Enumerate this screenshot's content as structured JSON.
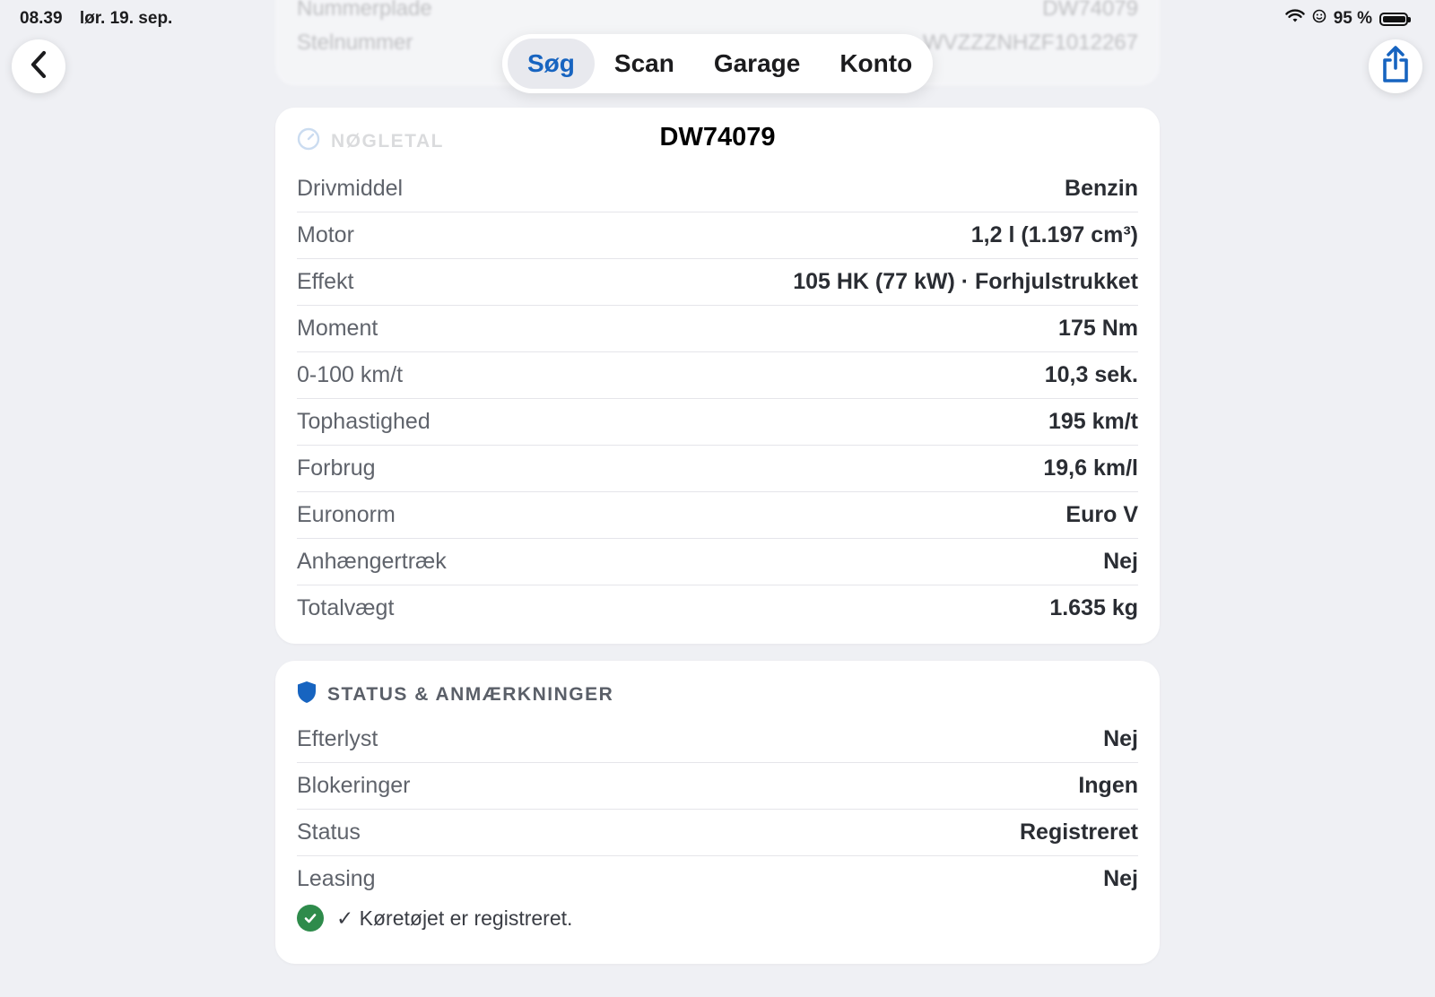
{
  "status_bar": {
    "time": "08.39",
    "date": "lør. 19. sep.",
    "battery": "95 %"
  },
  "nav_tabs": [
    {
      "label": "Søg",
      "active": true
    },
    {
      "label": "Scan",
      "active": false
    },
    {
      "label": "Garage",
      "active": false
    },
    {
      "label": "Konto",
      "active": false
    }
  ],
  "behind_card": {
    "rows": [
      {
        "label": "Nummerplade",
        "value": "DW74079"
      },
      {
        "label": "Stelnummer",
        "value": "WVZZZNHZF1012267"
      }
    ]
  },
  "key_figures": {
    "header": "NØGLETAL",
    "plate": "DW74079",
    "rows": [
      {
        "label": "Drivmiddel",
        "value": "Benzin"
      },
      {
        "label": "Motor",
        "value": "1,2 l (1.197 cm³)"
      },
      {
        "label": "Effekt",
        "value": "105 HK (77 kW) · Forhjulstrukket"
      },
      {
        "label": "Moment",
        "value": "175 Nm"
      },
      {
        "label": "0-100 km/t",
        "value": "10,3 sek."
      },
      {
        "label": "Tophastighed",
        "value": "195 km/t"
      },
      {
        "label": "Forbrug",
        "value": "19,6 km/l"
      },
      {
        "label": "Euronorm",
        "value": "Euro V"
      },
      {
        "label": "Anhængertræk",
        "value": "Nej"
      },
      {
        "label": "Totalvægt",
        "value": "1.635 kg"
      }
    ]
  },
  "status_section": {
    "header": "STATUS & ANMÆRKNINGER",
    "rows": [
      {
        "label": "Efterlyst",
        "value": "Nej"
      },
      {
        "label": "Blokeringer",
        "value": "Ingen"
      },
      {
        "label": "Status",
        "value": "Registreret"
      },
      {
        "label": "Leasing",
        "value": "Nej"
      }
    ],
    "note": "✓ Køretøjet er registreret."
  },
  "colors": {
    "accent": "#1764c0",
    "success": "#2e8b4b",
    "background": "#eff0f4"
  },
  "icons": {
    "back": "chevron-left-icon",
    "share": "share-icon",
    "key_figures": "gauge-icon",
    "status": "shield-icon",
    "registered": "check-circle-icon"
  }
}
